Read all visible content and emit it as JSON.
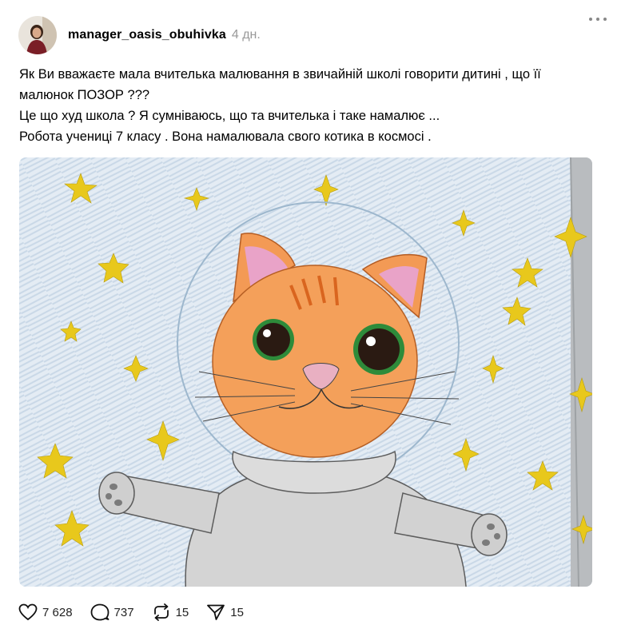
{
  "post": {
    "username": "manager_oasis_obuhivka",
    "timestamp": "4 дн.",
    "text_lines": [
      "Як Ви вважаєте мала вчителька малювання в звичайній школі говорити дитині , що її",
      "малюнок ПОЗОР ???",
      "Це що худ школа ? Я сумніваюсь, що та вчителька і таке намалює ...",
      "Робота учениці 7 класу . Вона намалювала свого котика в космосі ."
    ]
  },
  "actions": {
    "likes": "7 628",
    "comments": "737",
    "reposts": "15",
    "shares": "15"
  },
  "icons": {
    "like": "heart-icon",
    "comment": "comment-bubble-icon",
    "repost": "repost-icon",
    "share": "send-icon",
    "more": "more-dots-icon"
  },
  "colors": {
    "timestamp": "#999999",
    "star": "#e6c619",
    "cat_fur": "#f0964a",
    "space_bg": "#dfe8f1"
  }
}
